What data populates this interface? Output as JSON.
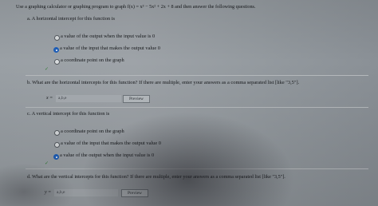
{
  "header": {
    "instructions": "Use a graphing calculator or graphing program to graph f(x) = x³ − 5x² + 2x + 8 and then answer the following questions."
  },
  "part_a": {
    "prompt": "a. A horizontal intercept for this function is",
    "options": [
      {
        "label": "a value of the output when the input value is 0",
        "selected": false
      },
      {
        "label": "a value of the input that makes the output value 0",
        "selected": true
      },
      {
        "label": "a coordinate point on the graph",
        "selected": false
      }
    ],
    "checkmark": "✓"
  },
  "part_b": {
    "prompt": "b. What are the horizontal intercepts for this function? If there are multiple, enter your answers as a comma separated list [like \"3,5\"].",
    "input_label": "x =",
    "input_value": "a,b,e",
    "preview_label": "Preview"
  },
  "part_c": {
    "prompt": "c. A vertical intercept for this function is",
    "options": [
      {
        "label": "a coordinate point on the graph",
        "selected": false
      },
      {
        "label": "a value of the input that makes the output value 0",
        "selected": false
      },
      {
        "label": "a value of the output when the input value is 0",
        "selected": true
      }
    ],
    "checkmark": "✓"
  },
  "part_d": {
    "prompt": "d. What are the vertical intercepts for this function? If there are multiple, enter your answers as a comma separated list [like \"3,5\"].",
    "input_label": "y =",
    "input_value": "a,b,e",
    "preview_label": "Preview"
  },
  "colors": {
    "selected_radio": "#1f5fb8",
    "check": "#2e7d32",
    "background": "#9ea3a8"
  }
}
